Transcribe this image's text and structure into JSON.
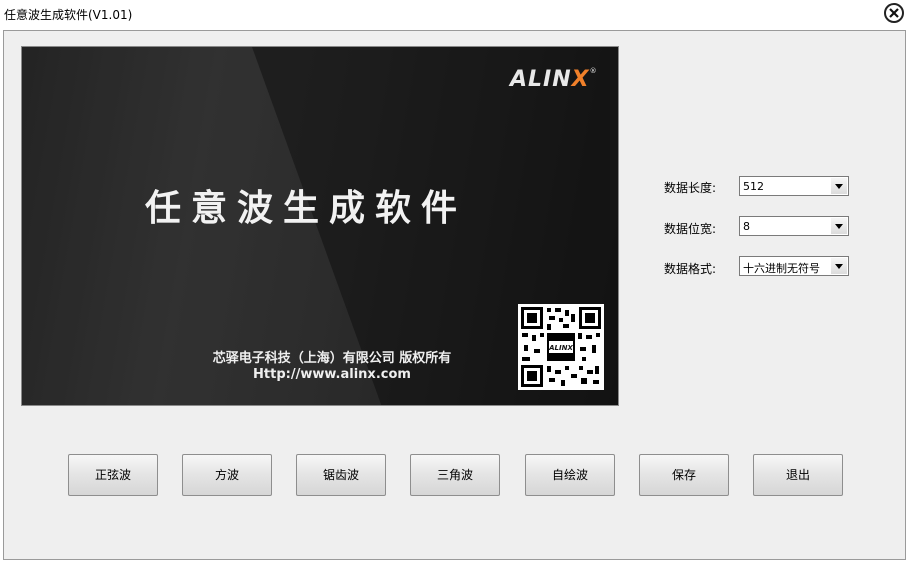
{
  "window": {
    "title": "任意波生成软件(V1.01)"
  },
  "banner": {
    "logo_text": "ALIN",
    "logo_x": "X",
    "logo_reg": "®",
    "title": "任意波生成软件",
    "company": "芯驿电子科技（上海）有限公司 版权所有",
    "url": "Http://www.alinx.com",
    "qr_center_label": "ALINX"
  },
  "settings": {
    "data_length": {
      "label": "数据长度:",
      "value": "512"
    },
    "data_width": {
      "label": "数据位宽:",
      "value": "8"
    },
    "data_format": {
      "label": "数据格式:",
      "value": "十六进制无符号"
    }
  },
  "buttons": [
    "正弦波",
    "方波",
    "锯齿波",
    "三角波",
    "自绘波",
    "保存",
    "退出"
  ],
  "colors": {
    "accent": "#f0802a",
    "banner_bg": "#222222",
    "client_bg": "#efefef"
  }
}
